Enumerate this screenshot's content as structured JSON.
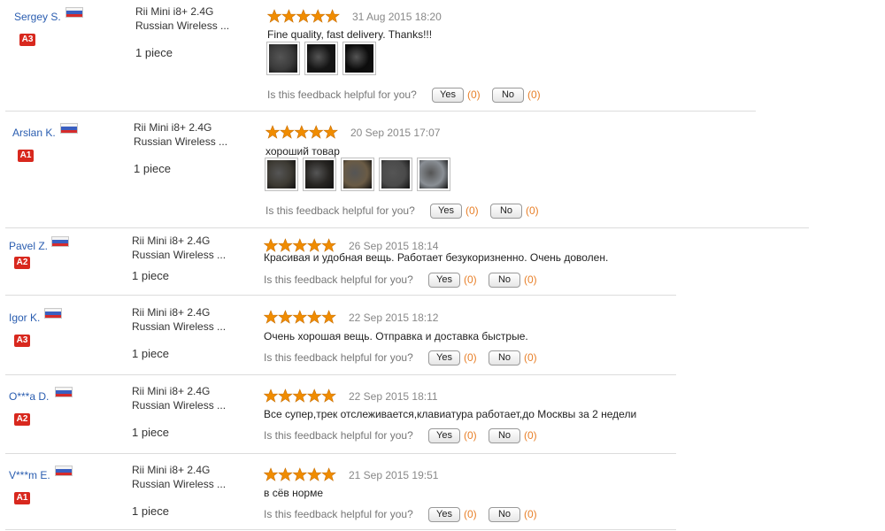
{
  "helpful_question": "Is this feedback helpful for you?",
  "yes_label": "Yes",
  "no_label": "No",
  "colors": {
    "username": "#2a5db0",
    "badge": "#d8281e",
    "star": "#f08c00",
    "vote_count": "#e8802a"
  },
  "reviews": [
    {
      "username": "Sergey S.",
      "flag": "russia-flag-icon",
      "level": "A3",
      "product_line1": "Rii Mini i8+ 2.4G",
      "product_line2": "Russian Wireless ...",
      "quantity": "1 piece",
      "rating": 5,
      "date": "31 Aug 2015 18:20",
      "feedback": "Fine quality, fast delivery. Thanks!!!",
      "photos": [
        "keyboard-photo",
        "keyboard-photo",
        "keyboard-photo"
      ],
      "yes_count": "(0)",
      "no_count": "(0)"
    },
    {
      "username": "Arslan K.",
      "flag": "russia-flag-icon",
      "level": "A1",
      "product_line1": "Rii Mini i8+ 2.4G",
      "product_line2": "Russian Wireless ...",
      "quantity": "1 piece",
      "rating": 5,
      "date": "20 Sep 2015 17:07",
      "feedback": "хороший товар",
      "photos": [
        "keyboard-photo",
        "keyboard-photo",
        "keyboard-photo",
        "keyboard-photo",
        "keyboard-photo"
      ],
      "yes_count": "(0)",
      "no_count": "(0)"
    },
    {
      "username": "Pavel Z.",
      "flag": "russia-flag-icon",
      "level": "A2",
      "product_line1": "Rii Mini i8+ 2.4G",
      "product_line2": "Russian Wireless ...",
      "quantity": "1 piece",
      "rating": 5,
      "date": "26 Sep 2015 18:14",
      "feedback": "Красивая и удобная вещь. Работает безукоризненно. Очень доволен.",
      "photos": [],
      "yes_count": "(0)",
      "no_count": "(0)"
    },
    {
      "username": "Igor K.",
      "flag": "russia-flag-icon",
      "level": "A3",
      "product_line1": "Rii Mini i8+ 2.4G",
      "product_line2": "Russian Wireless ...",
      "quantity": "1 piece",
      "rating": 5,
      "date": "22 Sep 2015 18:12",
      "feedback": "Очень хорошая вещь. Отправка и доставка быстрые.",
      "photos": [],
      "yes_count": "(0)",
      "no_count": "(0)"
    },
    {
      "username": "O***a D.",
      "flag": "russia-flag-icon",
      "level": "A2",
      "product_line1": "Rii Mini i8+ 2.4G",
      "product_line2": "Russian Wireless ...",
      "quantity": "1 piece",
      "rating": 5,
      "date": "22 Sep 2015 18:11",
      "feedback": "Все супер,трек отслеживается,клавиатура работает,до Москвы за 2 недели",
      "photos": [],
      "yes_count": "(0)",
      "no_count": "(0)"
    },
    {
      "username": "V***m E.",
      "flag": "russia-flag-icon",
      "level": "A1",
      "product_line1": "Rii Mini i8+ 2.4G",
      "product_line2": "Russian Wireless ...",
      "quantity": "1 piece",
      "rating": 5,
      "date": "21 Sep 2015 19:51",
      "feedback": "в сёв норме",
      "photos": [],
      "yes_count": "(0)",
      "no_count": "(0)"
    }
  ]
}
